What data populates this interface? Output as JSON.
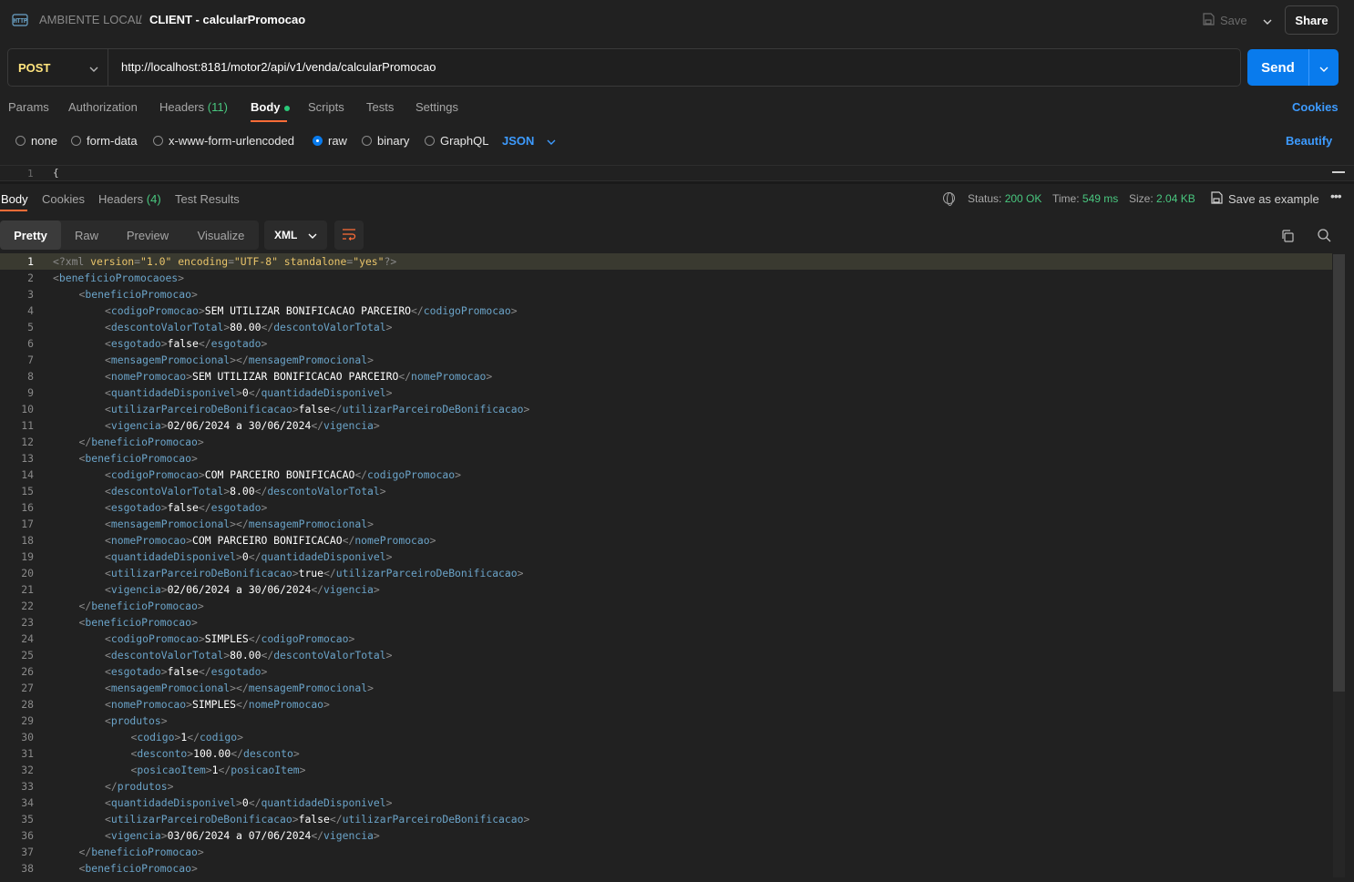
{
  "topbar": {
    "environment": "AMBIENTE LOCAL",
    "separator": "/",
    "request_title": "CLIENT - calcularPromocao",
    "save_label": "Save",
    "share_label": "Share"
  },
  "request": {
    "method": "POST",
    "url": "http://localhost:8181/motor2/api/v1/venda/calcularPromocao",
    "send_label": "Send"
  },
  "request_tabs": {
    "params": "Params",
    "authorization": "Authorization",
    "headers": "Headers",
    "headers_count": "(11)",
    "body": "Body",
    "scripts": "Scripts",
    "tests": "Tests",
    "settings": "Settings",
    "cookies": "Cookies"
  },
  "body_types": {
    "none": "none",
    "form_data": "form-data",
    "urlencoded": "x-www-form-urlencoded",
    "raw": "raw",
    "binary": "binary",
    "graphql": "GraphQL",
    "selected_format": "JSON",
    "beautify": "Beautify"
  },
  "request_editor": {
    "line_number": "1",
    "code": "{"
  },
  "response_tabs": {
    "body": "Body",
    "cookies": "Cookies",
    "headers": "Headers",
    "headers_count": "(4)",
    "test_results": "Test Results"
  },
  "response_meta": {
    "status_label": "Status:",
    "status_value": "200 OK",
    "time_label": "Time:",
    "time_value": "549 ms",
    "size_label": "Size:",
    "size_value": "2.04 KB",
    "save_example": "Save as example"
  },
  "view_tabs": {
    "pretty": "Pretty",
    "raw": "Raw",
    "preview": "Preview",
    "visualize": "Visualize",
    "format": "XML"
  },
  "colors": {
    "accent": "#ff6c37",
    "send": "#097bed",
    "status_ok": "#49c77f",
    "method_post": "#ffe47e",
    "xml_tag": "#6ba4c9"
  },
  "response_lines": [
    {
      "n": "1",
      "indent": 0,
      "kind": "pi",
      "text": "<?xml version=\"1.0\" encoding=\"UTF-8\" standalone=\"yes\"?>"
    },
    {
      "n": "2",
      "indent": 0,
      "kind": "open",
      "tag": "beneficioPromocaoes"
    },
    {
      "n": "3",
      "indent": 1,
      "kind": "open",
      "tag": "beneficioPromocao"
    },
    {
      "n": "4",
      "indent": 2,
      "kind": "elem",
      "tag": "codigoPromocao",
      "value": "SEM UTILIZAR BONIFICACAO PARCEIRO"
    },
    {
      "n": "5",
      "indent": 2,
      "kind": "elem",
      "tag": "descontoValorTotal",
      "value": "80.00"
    },
    {
      "n": "6",
      "indent": 2,
      "kind": "elem",
      "tag": "esgotado",
      "value": "false"
    },
    {
      "n": "7",
      "indent": 2,
      "kind": "elem",
      "tag": "mensagemPromocional",
      "value": ""
    },
    {
      "n": "8",
      "indent": 2,
      "kind": "elem",
      "tag": "nomePromocao",
      "value": "SEM UTILIZAR BONIFICACAO PARCEIRO"
    },
    {
      "n": "9",
      "indent": 2,
      "kind": "elem",
      "tag": "quantidadeDisponivel",
      "value": "0"
    },
    {
      "n": "10",
      "indent": 2,
      "kind": "elem",
      "tag": "utilizarParceiroDeBonificacao",
      "value": "false"
    },
    {
      "n": "11",
      "indent": 2,
      "kind": "elem",
      "tag": "vigencia",
      "value": "02/06/2024 a 30/06/2024"
    },
    {
      "n": "12",
      "indent": 1,
      "kind": "close",
      "tag": "beneficioPromocao"
    },
    {
      "n": "13",
      "indent": 1,
      "kind": "open",
      "tag": "beneficioPromocao"
    },
    {
      "n": "14",
      "indent": 2,
      "kind": "elem",
      "tag": "codigoPromocao",
      "value": "COM PARCEIRO BONIFICACAO"
    },
    {
      "n": "15",
      "indent": 2,
      "kind": "elem",
      "tag": "descontoValorTotal",
      "value": "8.00"
    },
    {
      "n": "16",
      "indent": 2,
      "kind": "elem",
      "tag": "esgotado",
      "value": "false"
    },
    {
      "n": "17",
      "indent": 2,
      "kind": "elem",
      "tag": "mensagemPromocional",
      "value": ""
    },
    {
      "n": "18",
      "indent": 2,
      "kind": "elem",
      "tag": "nomePromocao",
      "value": "COM PARCEIRO BONIFICACAO"
    },
    {
      "n": "19",
      "indent": 2,
      "kind": "elem",
      "tag": "quantidadeDisponivel",
      "value": "0"
    },
    {
      "n": "20",
      "indent": 2,
      "kind": "elem",
      "tag": "utilizarParceiroDeBonificacao",
      "value": "true"
    },
    {
      "n": "21",
      "indent": 2,
      "kind": "elem",
      "tag": "vigencia",
      "value": "02/06/2024 a 30/06/2024"
    },
    {
      "n": "22",
      "indent": 1,
      "kind": "close",
      "tag": "beneficioPromocao"
    },
    {
      "n": "23",
      "indent": 1,
      "kind": "open",
      "tag": "beneficioPromocao"
    },
    {
      "n": "24",
      "indent": 2,
      "kind": "elem",
      "tag": "codigoPromocao",
      "value": "SIMPLES"
    },
    {
      "n": "25",
      "indent": 2,
      "kind": "elem",
      "tag": "descontoValorTotal",
      "value": "80.00"
    },
    {
      "n": "26",
      "indent": 2,
      "kind": "elem",
      "tag": "esgotado",
      "value": "false"
    },
    {
      "n": "27",
      "indent": 2,
      "kind": "elem",
      "tag": "mensagemPromocional",
      "value": ""
    },
    {
      "n": "28",
      "indent": 2,
      "kind": "elem",
      "tag": "nomePromocao",
      "value": "SIMPLES"
    },
    {
      "n": "29",
      "indent": 2,
      "kind": "open",
      "tag": "produtos"
    },
    {
      "n": "30",
      "indent": 3,
      "kind": "elem",
      "tag": "codigo",
      "value": "1"
    },
    {
      "n": "31",
      "indent": 3,
      "kind": "elem",
      "tag": "desconto",
      "value": "100.00"
    },
    {
      "n": "32",
      "indent": 3,
      "kind": "elem",
      "tag": "posicaoItem",
      "value": "1"
    },
    {
      "n": "33",
      "indent": 2,
      "kind": "close",
      "tag": "produtos"
    },
    {
      "n": "34",
      "indent": 2,
      "kind": "elem",
      "tag": "quantidadeDisponivel",
      "value": "0"
    },
    {
      "n": "35",
      "indent": 2,
      "kind": "elem",
      "tag": "utilizarParceiroDeBonificacao",
      "value": "false"
    },
    {
      "n": "36",
      "indent": 2,
      "kind": "elem",
      "tag": "vigencia",
      "value": "03/06/2024 a 07/06/2024"
    },
    {
      "n": "37",
      "indent": 1,
      "kind": "close",
      "tag": "beneficioPromocao"
    },
    {
      "n": "38",
      "indent": 1,
      "kind": "open",
      "tag": "beneficioPromocao"
    }
  ]
}
